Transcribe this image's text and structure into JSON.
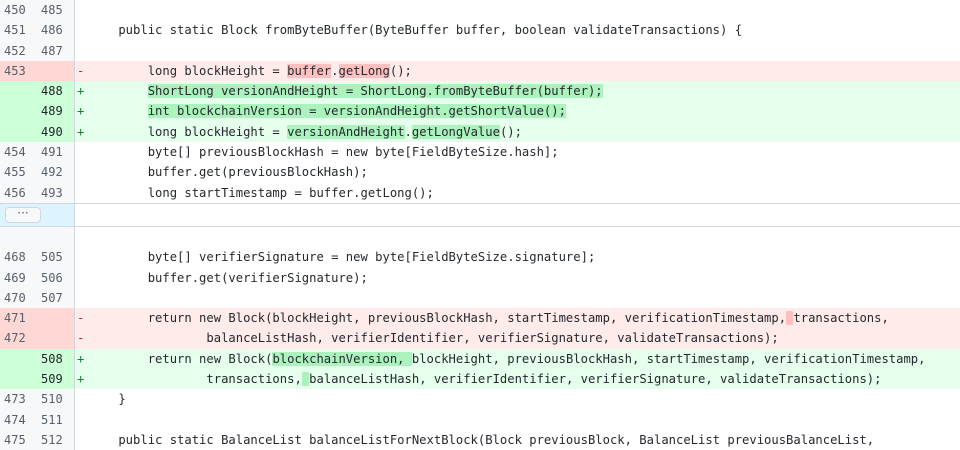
{
  "expander": {
    "label": "···"
  },
  "hunk1": [
    {
      "type": "ctx",
      "old": "450",
      "new": "485",
      "mark": "",
      "segs": [
        {
          "t": ""
        }
      ]
    },
    {
      "type": "ctx",
      "old": "451",
      "new": "486",
      "mark": "",
      "segs": [
        {
          "t": "    public static Block fromByteBuffer(ByteBuffer buffer, boolean validateTransactions) {"
        }
      ]
    },
    {
      "type": "ctx",
      "old": "452",
      "new": "487",
      "mark": "",
      "segs": [
        {
          "t": ""
        }
      ]
    },
    {
      "type": "del",
      "old": "453",
      "new": "",
      "mark": "-",
      "segs": [
        {
          "t": "        long blockHeight = "
        },
        {
          "t": "buffer",
          "h": 1
        },
        {
          "t": "."
        },
        {
          "t": "getLong",
          "h": 1
        },
        {
          "t": "();"
        }
      ]
    },
    {
      "type": "add",
      "old": "",
      "new": "488",
      "mark": "+",
      "segs": [
        {
          "t": "        "
        },
        {
          "t": "ShortLong versionAndHeight = ShortLong.fromByteBuffer(buffer);",
          "h": 1
        }
      ]
    },
    {
      "type": "add",
      "old": "",
      "new": "489",
      "mark": "+",
      "segs": [
        {
          "t": "        "
        },
        {
          "t": "int blockchainVersion = versionAndHeight.getShortValue();",
          "h": 1
        }
      ]
    },
    {
      "type": "add",
      "old": "",
      "new": "490",
      "mark": "+",
      "segs": [
        {
          "t": "        long blockHeight = "
        },
        {
          "t": "versionAndHeight",
          "h": 1
        },
        {
          "t": "."
        },
        {
          "t": "getLongValue",
          "h": 1
        },
        {
          "t": "();"
        }
      ]
    },
    {
      "type": "ctx",
      "old": "454",
      "new": "491",
      "mark": "",
      "segs": [
        {
          "t": "        byte[] previousBlockHash = new byte[FieldByteSize.hash];"
        }
      ]
    },
    {
      "type": "ctx",
      "old": "455",
      "new": "492",
      "mark": "",
      "segs": [
        {
          "t": "        buffer.get(previousBlockHash);"
        }
      ]
    },
    {
      "type": "ctx",
      "old": "456",
      "new": "493",
      "mark": "",
      "segs": [
        {
          "t": "        long startTimestamp = buffer.getLong();"
        }
      ]
    }
  ],
  "hunk2": [
    {
      "type": "ctx",
      "old": "",
      "new": "",
      "mark": "",
      "segs": [
        {
          "t": ""
        }
      ]
    },
    {
      "type": "ctx",
      "old": "468",
      "new": "505",
      "mark": "",
      "segs": [
        {
          "t": "        byte[] verifierSignature = new byte[FieldByteSize.signature];"
        }
      ]
    },
    {
      "type": "ctx",
      "old": "469",
      "new": "506",
      "mark": "",
      "segs": [
        {
          "t": "        buffer.get(verifierSignature);"
        }
      ]
    },
    {
      "type": "ctx",
      "old": "470",
      "new": "507",
      "mark": "",
      "segs": [
        {
          "t": ""
        }
      ]
    },
    {
      "type": "del",
      "old": "471",
      "new": "",
      "mark": "-",
      "segs": [
        {
          "t": "        return new Block(blockHeight, previousBlockHash, startTimestamp, verificationTimestamp,"
        },
        {
          "t": " ",
          "h": 1
        },
        {
          "t": "transactions,"
        }
      ]
    },
    {
      "type": "del",
      "old": "472",
      "new": "",
      "mark": "-",
      "segs": [
        {
          "t": "                balanceListHash, verifierIdentifier, verifierSignature, validateTransactions);"
        }
      ]
    },
    {
      "type": "add",
      "old": "",
      "new": "508",
      "mark": "+",
      "segs": [
        {
          "t": "        return new Block("
        },
        {
          "t": "blockchainVersion, ",
          "h": 1
        },
        {
          "t": "blockHeight, previousBlockHash, startTimestamp, verificationTimestamp,"
        }
      ]
    },
    {
      "type": "add",
      "old": "",
      "new": "509",
      "mark": "+",
      "segs": [
        {
          "t": "                transactions,"
        },
        {
          "t": " ",
          "h": 1
        },
        {
          "t": "balanceListHash, verifierIdentifier, verifierSignature, validateTransactions);"
        }
      ]
    },
    {
      "type": "ctx",
      "old": "473",
      "new": "510",
      "mark": "",
      "segs": [
        {
          "t": "    }"
        }
      ]
    },
    {
      "type": "ctx",
      "old": "474",
      "new": "511",
      "mark": "",
      "segs": [
        {
          "t": ""
        }
      ]
    },
    {
      "type": "ctx",
      "old": "475",
      "new": "512",
      "mark": "",
      "segs": [
        {
          "t": "    public static BalanceList balanceListForNextBlock(Block previousBlock, BalanceList previousBalanceList,"
        }
      ]
    }
  ]
}
